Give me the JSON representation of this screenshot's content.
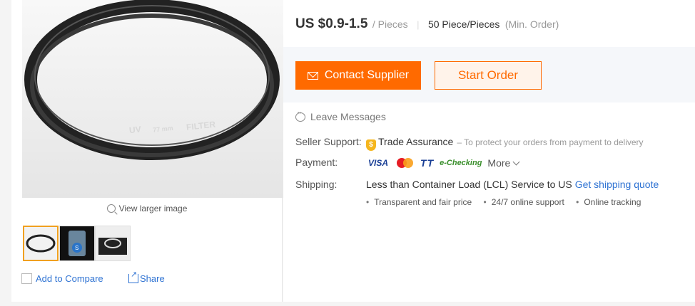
{
  "gallery": {
    "product_image_text": {
      "brand": "UV",
      "size": "77 mm",
      "type": "FILTER"
    },
    "view_larger": "View larger image",
    "thumbnails": [
      "thumb-filter",
      "thumb-package",
      "thumb-kit"
    ],
    "add_to_compare": "Add to Compare",
    "share": "Share"
  },
  "pricing": {
    "price": "US $0.9-1.5",
    "unit": "/ Pieces",
    "moq": "50 Piece/Pieces",
    "moq_note": "(Min. Order)"
  },
  "actions": {
    "contact": "Contact Supplier",
    "start_order": "Start Order",
    "leave_messages": "Leave Messages"
  },
  "details": {
    "seller_support_label": "Seller Support:",
    "trade_assurance": "Trade Assurance",
    "trade_assurance_note": "– To protect your orders from payment to delivery",
    "payment_label": "Payment:",
    "payment_methods": {
      "visa": "VISA",
      "tt": "TT",
      "echecking": "e-Checking"
    },
    "more": "More",
    "shipping_label": "Shipping:",
    "shipping_text": "Less than Container Load (LCL) Service to US",
    "shipping_link": "Get shipping quote",
    "shipping_features": [
      "Transparent and fair price",
      "24/7 online support",
      "Online tracking"
    ]
  },
  "colors": {
    "accent": "#ff6a00",
    "link": "#2f73d3",
    "thumb_active": "#f0a020"
  }
}
